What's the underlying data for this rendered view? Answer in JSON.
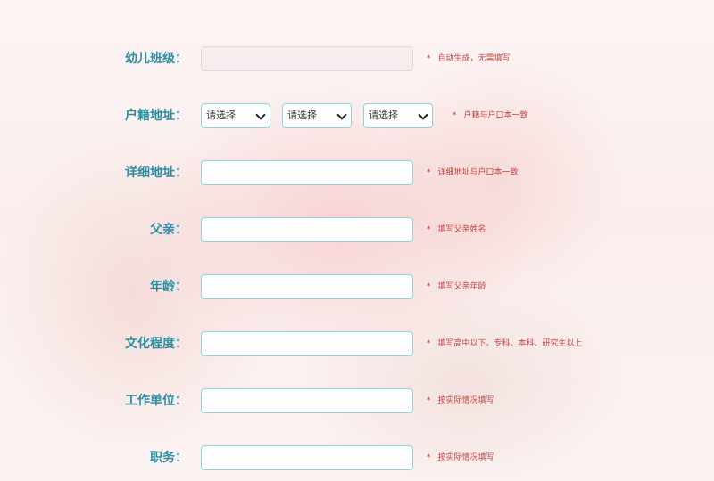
{
  "colors": {
    "label": "#2a8fa3",
    "border": "#8fd4dc",
    "hint": "#c8423f"
  },
  "rows": [
    {
      "label": "幼儿班级：",
      "value": "",
      "hint": "自动生成，无需填写"
    },
    {
      "label": "户籍地址：",
      "selects": [
        "请选择",
        "请选择",
        "请选择"
      ],
      "hint": "户籍与户口本一致"
    },
    {
      "label": "详细地址：",
      "value": "",
      "hint": "详细地址与户口本一致"
    },
    {
      "label": "父亲：",
      "value": "",
      "hint": "填写父亲姓名"
    },
    {
      "label": "年龄：",
      "value": "",
      "hint": "填写父亲年龄"
    },
    {
      "label": "文化程度：",
      "value": "",
      "hint": "填写高中以下、专科、本科、研究生以上"
    },
    {
      "label": "工作单位：",
      "value": "",
      "hint": "按实际情况填写"
    },
    {
      "label": "职务：",
      "value": "",
      "hint": "按实际情况填写"
    }
  ],
  "star": "*"
}
